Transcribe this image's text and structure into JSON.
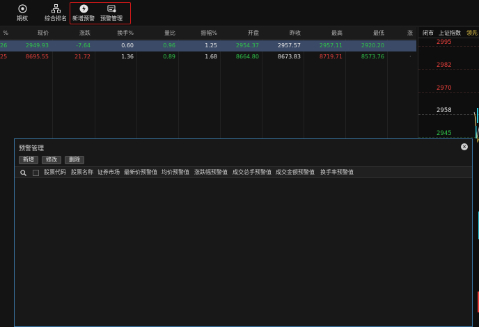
{
  "toolbar": {
    "items": [
      {
        "label": "期权",
        "icon": "options-target-icon"
      },
      {
        "label": "综合排名",
        "icon": "ranking-hierarchy-icon"
      },
      {
        "label": "新增预警",
        "icon": "add-alert-icon"
      },
      {
        "label": "预警管理",
        "icon": "alert-manage-icon"
      }
    ]
  },
  "table": {
    "headers": [
      "%",
      "现价",
      "涨跌",
      "换手%",
      "量比",
      "振幅%",
      "开盘",
      "昨收",
      "最高",
      "最低",
      "涨"
    ],
    "rows": [
      {
        "pct": "26",
        "price": "2949.93",
        "change": "-7.64",
        "turnover": "0.60",
        "volratio": "0.96",
        "amplitude": "1.25",
        "open": "2954.37",
        "prevclose": "2957.57",
        "high": "2957.11",
        "low": "2920.20"
      },
      {
        "pct": "25",
        "price": "8695.55",
        "change": "21.72",
        "turnover": "1.36",
        "volratio": "0.89",
        "amplitude": "1.68",
        "open": "8664.80",
        "prevclose": "8673.83",
        "high": "8719.71",
        "low": "8573.76",
        "extra": "·"
      }
    ]
  },
  "right_panel": {
    "tabs": [
      "闭市",
      "上证指数",
      "领先"
    ],
    "prices": [
      "2995",
      "2982",
      "2970",
      "2958",
      "2945"
    ]
  },
  "dialog": {
    "title": "预警管理",
    "buttons": [
      "新增",
      "修改",
      "删除"
    ],
    "columns": [
      "股票代码",
      "股票名称",
      "证券市场",
      "最新价预警值",
      "均价预警值",
      "涨跌幅预警值",
      "成交总手预警值",
      "成交金额预警值",
      "换手率预警值"
    ]
  },
  "colors": {
    "up": "#e8403c",
    "down": "#2fc54a",
    "highlight": "#d01818",
    "dialog_border": "#3b78a8",
    "selected_row": "#3b4a66"
  }
}
